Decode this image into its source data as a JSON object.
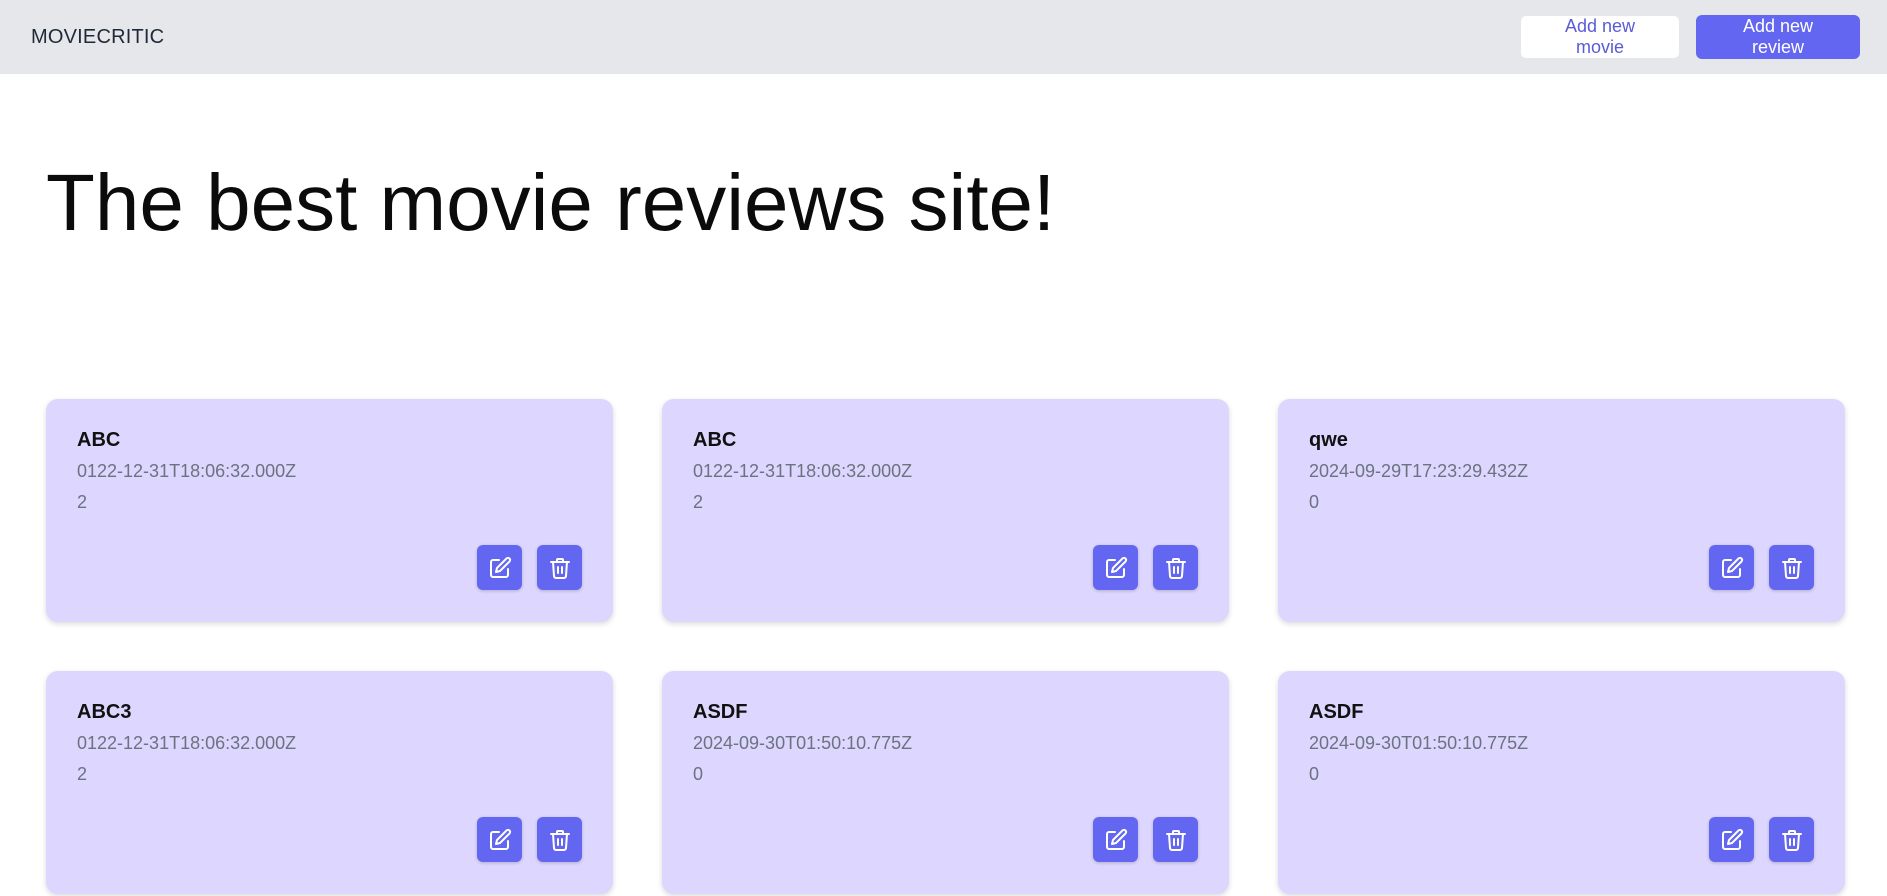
{
  "header": {
    "brand": "MOVIECRITIC",
    "add_movie_label": "Add new movie",
    "add_review_label": "Add new review"
  },
  "hero": {
    "title": "The best movie reviews site!"
  },
  "cards": [
    {
      "title": "ABC",
      "date": "0122-12-31T18:06:32.000Z",
      "score": "2"
    },
    {
      "title": "ABC",
      "date": "0122-12-31T18:06:32.000Z",
      "score": "2"
    },
    {
      "title": "qwe",
      "date": "2024-09-29T17:23:29.432Z",
      "score": "0"
    },
    {
      "title": "ABC3",
      "date": "0122-12-31T18:06:32.000Z",
      "score": "2"
    },
    {
      "title": "ASDF",
      "date": "2024-09-30T01:50:10.775Z",
      "score": "0"
    },
    {
      "title": "ASDF",
      "date": "2024-09-30T01:50:10.775Z",
      "score": "0"
    }
  ],
  "icons": {
    "edit": "edit-icon",
    "delete": "trash-icon"
  },
  "colors": {
    "accent": "#6366f1",
    "card_bg": "#ddd6fe",
    "header_bg": "#e5e7eb"
  }
}
